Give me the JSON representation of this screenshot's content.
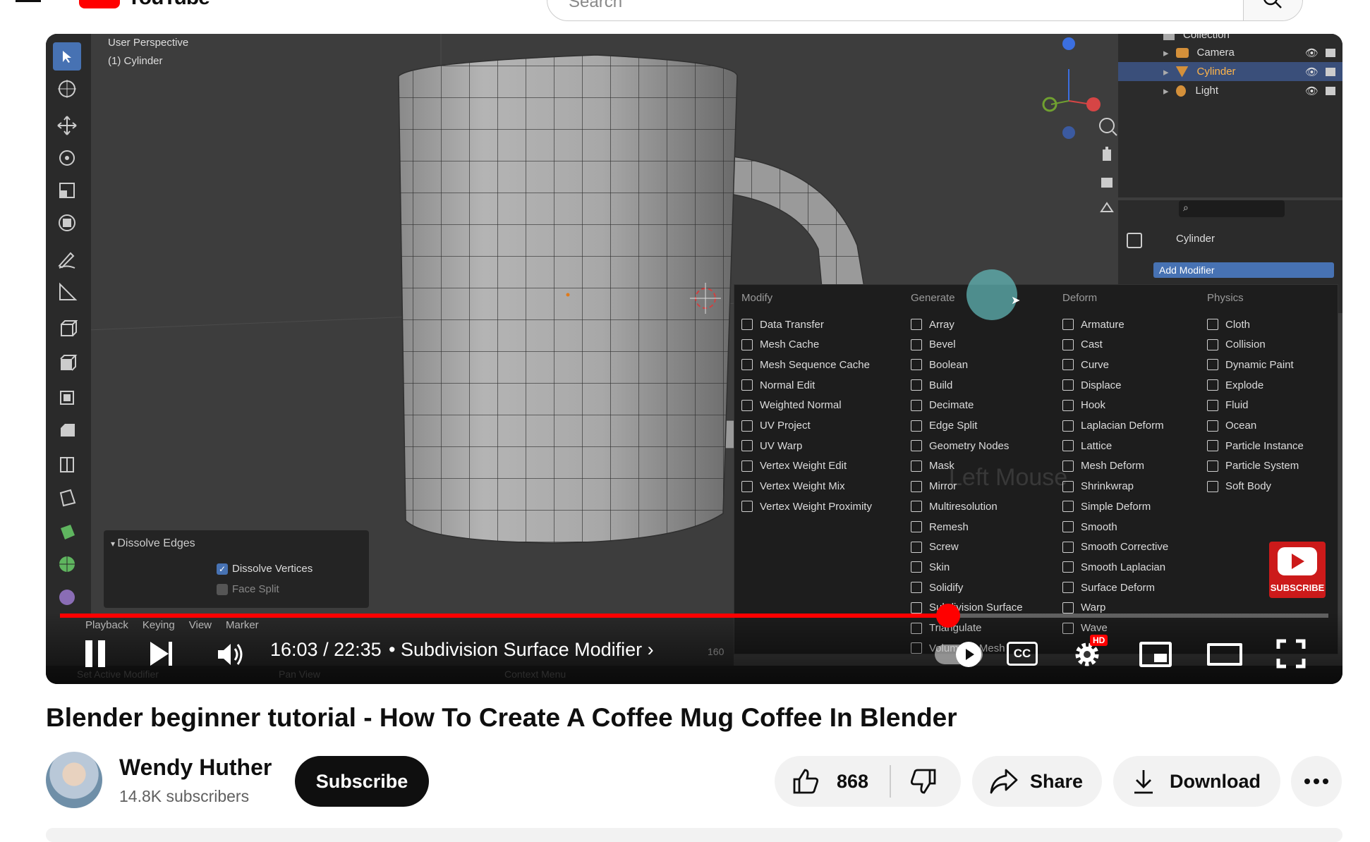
{
  "header": {
    "search_placeholder": "Search"
  },
  "blender": {
    "viewport_title": "User Perspective",
    "viewport_object": "(1) Cylinder",
    "outliner": [
      {
        "label": "Collection"
      },
      {
        "label": "Camera"
      },
      {
        "label": "Cylinder"
      },
      {
        "label": "Light"
      }
    ],
    "properties": {
      "search_placeholder": "",
      "object_name": "Cylinder",
      "add_modifier_label": "Add Modifier"
    },
    "menu": {
      "columns": [
        {
          "title": "Modify",
          "items": [
            "Data Transfer",
            "Mesh Cache",
            "Mesh Sequence Cache",
            "Normal Edit",
            "Weighted Normal",
            "UV Project",
            "UV Warp",
            "Vertex Weight Edit",
            "Vertex Weight Mix",
            "Vertex Weight Proximity"
          ]
        },
        {
          "title": "Generate",
          "items": [
            "Array",
            "Bevel",
            "Boolean",
            "Build",
            "Decimate",
            "Edge Split",
            "Geometry Nodes",
            "Mask",
            "Mirror",
            "Multiresolution",
            "Remesh",
            "Screw",
            "Skin",
            "Solidify",
            "Subdivision Surface",
            "Triangulate",
            "Volume to Mesh"
          ]
        },
        {
          "title": "Deform",
          "items": [
            "Armature",
            "Cast",
            "Curve",
            "Displace",
            "Hook",
            "Laplacian Deform",
            "Lattice",
            "Mesh Deform",
            "Shrinkwrap",
            "Simple Deform",
            "Smooth",
            "Smooth Corrective",
            "Smooth Laplacian",
            "Surface Deform",
            "Warp",
            "Wave"
          ]
        },
        {
          "title": "Physics",
          "items": [
            "Cloth",
            "Collision",
            "Dynamic Paint",
            "Explode",
            "Fluid",
            "Ocean",
            "Particle Instance",
            "Particle System",
            "Soft Body"
          ]
        }
      ]
    },
    "watermark": "Left Mouse",
    "dissolve_panel": {
      "title": "Dissolve Edges",
      "vertices_label": "Dissolve Vertices",
      "face_split_label": "Face Split"
    },
    "timeline": {
      "menus": [
        "Playback",
        "Keying",
        "View",
        "Marker"
      ],
      "end_frame": "160"
    },
    "status_bar": [
      "Set Active Modifier",
      "Pan View",
      "Context Menu"
    ]
  },
  "player": {
    "time": "16:03 / 22:35",
    "chapter": "Subdivision Surface Modifier",
    "progress": 0.7,
    "subscribe_badge": "SUBSCRIBE",
    "hd_badge": "HD",
    "cc_label": "CC"
  },
  "video": {
    "title": "Blender beginner tutorial - How To Create A Coffee Mug Coffee In Blender",
    "channel": "Wendy Huther",
    "subscribers": "14.8K subscribers",
    "subscribe_label": "Subscribe",
    "likes": "868",
    "share_label": "Share",
    "download_label": "Download"
  },
  "colors": {
    "accent": "#ff0000",
    "subscribe_bg": "#0f0f0f",
    "blender_selected": "#3a4f7a"
  }
}
